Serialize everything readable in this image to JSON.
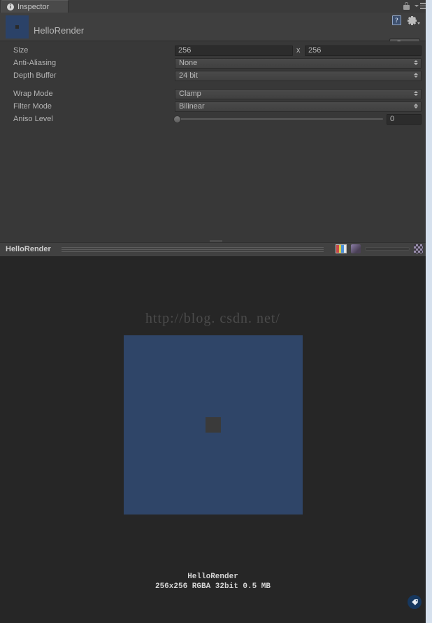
{
  "window": {
    "tab": {
      "label": "Inspector",
      "icon": "info-icon"
    },
    "lock_icon": "lock-icon",
    "menu_icon": "hamburger-menu-icon"
  },
  "object_header": {
    "title": "HelloRender",
    "thumbnail_icon": "render-texture-thumbnail",
    "help_icon": "help-book-icon",
    "help_glyph": "?",
    "settings_icon": "gear-icon",
    "open_button": "Open"
  },
  "properties": [
    {
      "label": "Size",
      "type": "size",
      "width": "256",
      "separator": "x",
      "height": "256"
    },
    {
      "label": "Anti-Aliasing",
      "type": "dropdown",
      "value": "None"
    },
    {
      "label": "Depth Buffer",
      "type": "dropdown",
      "value": "24 bit"
    },
    {
      "label": "Wrap Mode",
      "type": "dropdown",
      "value": "Clamp"
    },
    {
      "label": "Filter Mode",
      "type": "dropdown",
      "value": "Bilinear"
    },
    {
      "label": "Aniso Level",
      "type": "slider",
      "value": "0"
    }
  ],
  "preview": {
    "title": "HelloRender",
    "tools": {
      "rgb_icon": "rgb-channels-icon",
      "material_icon": "material-sphere-icon",
      "mip_slider": "mip-level-slider",
      "checker_icon": "alpha-checker-icon"
    },
    "watermark": "http://blog. csdn. net/",
    "asset_name": "HelloRender",
    "asset_info": "256x256  RGBA 32bit  0.5 MB",
    "tag_badge_icon": "tag-icon",
    "colors": {
      "texture_blue": "#2f4568",
      "texture_center": "#3a3a3a",
      "background": "#262626"
    }
  }
}
